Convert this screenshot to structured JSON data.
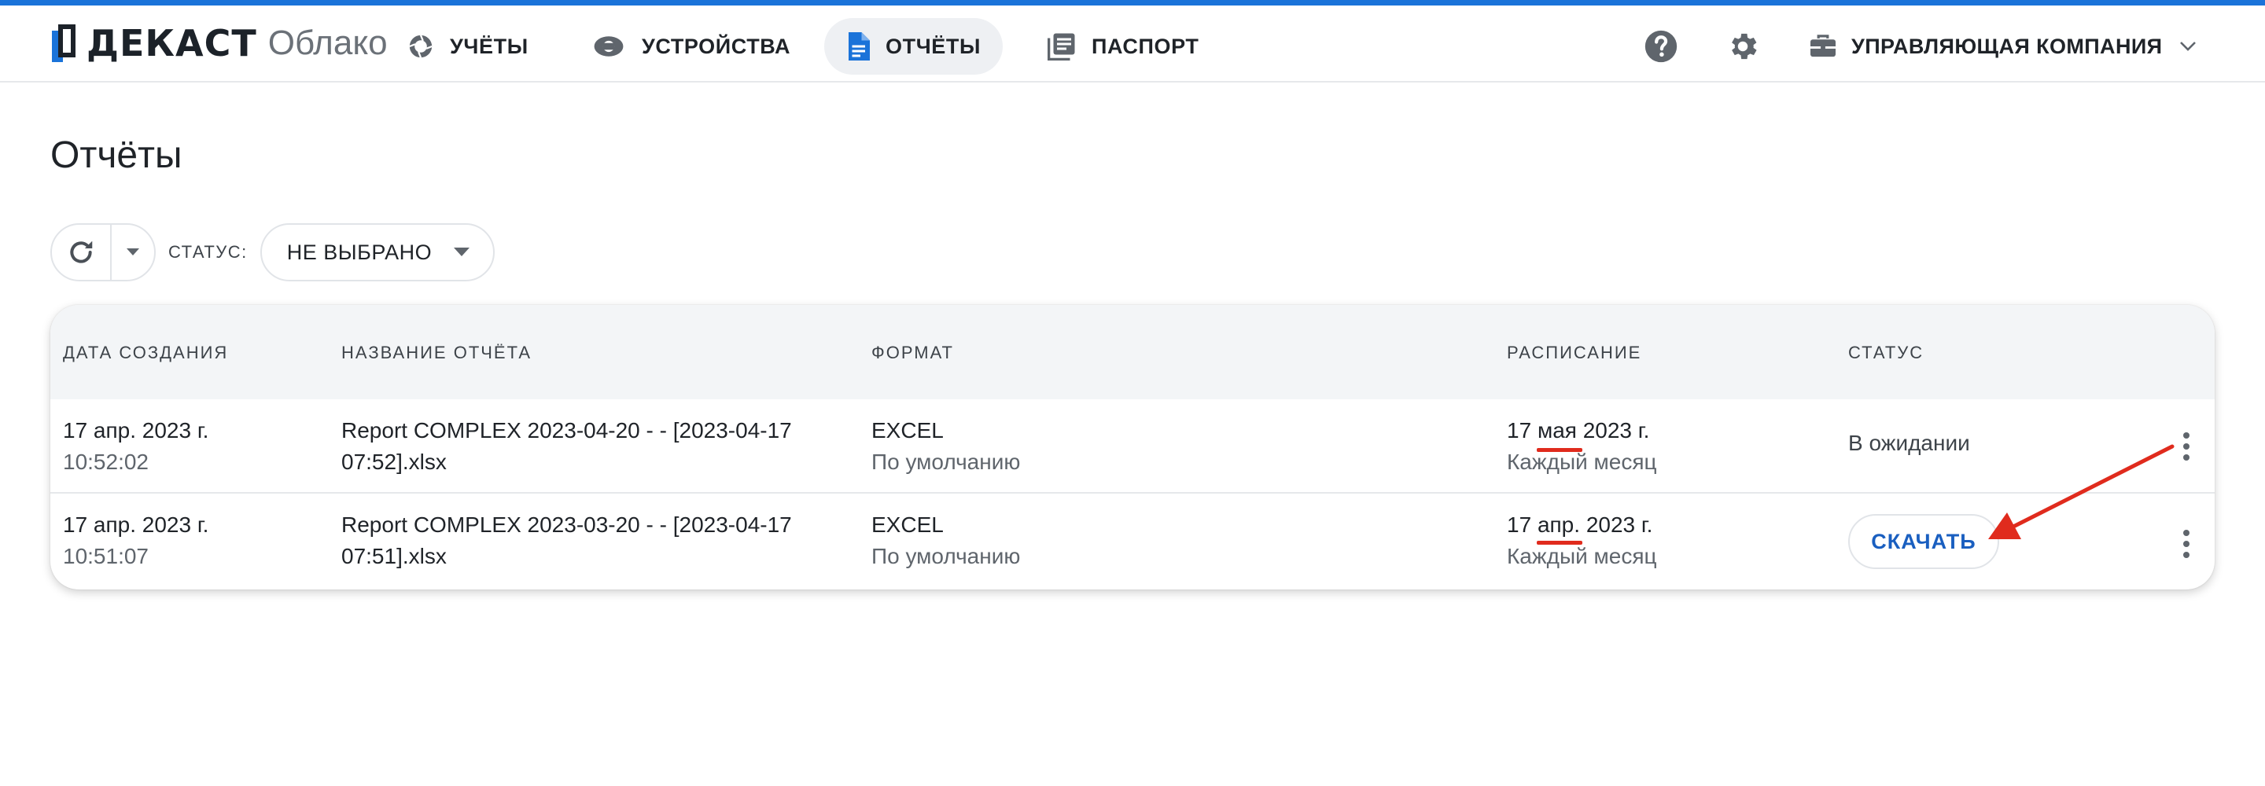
{
  "colors": {
    "accent": "#1a73d9",
    "link_blue": "#1a5fc0",
    "annotation_red": "#e02b1d",
    "header_bg": "#f3f5f7",
    "active_nav_bg": "#eef0f3"
  },
  "brand": {
    "name": "ДЕКАСТ",
    "product": "Облако"
  },
  "nav": {
    "items": [
      {
        "label": "УЧЁТЫ",
        "icon": "aperture-icon"
      },
      {
        "label": "УСТРОЙСТВА",
        "icon": "device-icon"
      },
      {
        "label": "ОТЧЁТЫ",
        "icon": "document-icon",
        "active": true
      },
      {
        "label": "ПАСПОРТ",
        "icon": "passport-icon"
      }
    ],
    "help_icon": "help-circle-icon",
    "settings_icon": "gear-icon",
    "company": {
      "label": "УПРАВЛЯЮЩАЯ КОМПАНИЯ",
      "icon": "briefcase-icon"
    }
  },
  "page": {
    "title": "Отчёты"
  },
  "toolbar": {
    "refresh_icon": "refresh-icon",
    "status_label": "СТАТУС:",
    "status_value": "НЕ ВЫБРАНО"
  },
  "table": {
    "columns": [
      "ДАТА СОЗДАНИЯ",
      "НАЗВАНИЕ ОТЧЁТА",
      "ФОРМАТ",
      "РАСПИСАНИЕ",
      "СТАТУС"
    ],
    "rows": [
      {
        "date": "17 апр. 2023 г.",
        "time": "10:52:02",
        "name_line1": "Report COMPLEX 2023-04-20 - - [2023-04-17",
        "name_line2": "07:52].xlsx",
        "format": "EXCEL",
        "format_sub": "По умолчанию",
        "schedule_day": "17",
        "schedule_month": "мая",
        "schedule_year": "2023 г.",
        "schedule_sub": "Каждый месяц",
        "status": "В ожидании"
      },
      {
        "date": "17 апр. 2023 г.",
        "time": "10:51:07",
        "name_line1": "Report COMPLEX 2023-03-20 - - [2023-04-17",
        "name_line2": "07:51].xlsx",
        "format": "EXCEL",
        "format_sub": "По умолчанию",
        "schedule_day": "17",
        "schedule_month": "апр.",
        "schedule_year": "2023 г.",
        "schedule_sub": "Каждый месяц",
        "status_button": "СКАЧАТЬ"
      }
    ]
  }
}
